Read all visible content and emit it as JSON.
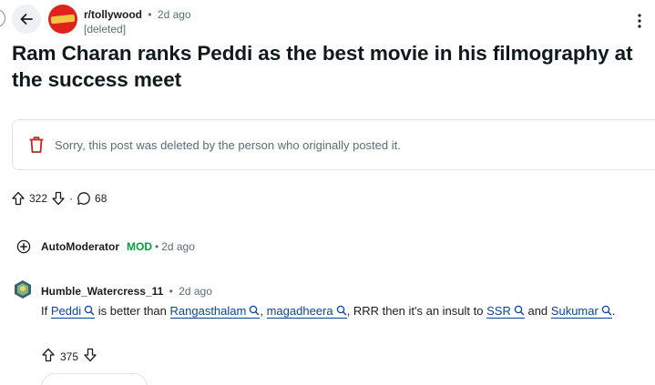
{
  "header": {
    "subreddit": "r/tollywood",
    "separator": "•",
    "time": "2d ago",
    "author": "[deleted]",
    "icons": {
      "back": "arrow-left-icon",
      "menu": "kebab-vertical-icon"
    },
    "subreddit_avatar_color": "#e0221c"
  },
  "post": {
    "title": "Ram Charan ranks Peddi as the best movie in his filmography at the success meet",
    "deleted_notice": "Sorry, this post was deleted by the person who originally posted it.",
    "deleted_icon": "trash-icon",
    "deleted_icon_color": "#c2261e",
    "upvotes": "322",
    "separator": "·",
    "comments": "68"
  },
  "comments": [
    {
      "username": "AutoModerator",
      "badge": "MOD",
      "separator": "•",
      "time": "2d ago",
      "collapsed": true,
      "badge_color": "#07a03a"
    },
    {
      "username": "Humble_Watercress_11",
      "separator": "•",
      "time": "2d ago",
      "body": {
        "prefix": "If",
        "kw1": "Peddi",
        "mid1": "is better than",
        "kw2": "Rangasthalam",
        "comma": ",",
        "kw3": "magadheera",
        "mid2": ", RRR then it's an insult to",
        "kw4": "SSR",
        "and": "and",
        "kw5": "Sukumar",
        "period": "."
      },
      "upvotes": "375",
      "link_color": "#0a449b"
    }
  ]
}
